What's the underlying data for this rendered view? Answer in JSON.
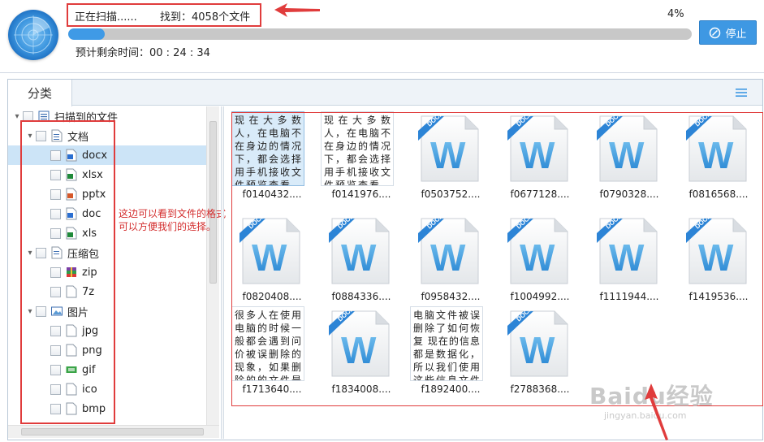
{
  "scan": {
    "status": "正在扫描......",
    "found": "找到：4058个文件",
    "percent": "4%",
    "progress": 0.04,
    "eta": "预计剩余时间：00 : 24 : 34",
    "stop_label": "停止"
  },
  "panel": {
    "tab": "分类"
  },
  "tree": {
    "items": [
      {
        "label": "扫描到的文件",
        "level": 0,
        "toggle": "▾",
        "icon": "list-icon"
      },
      {
        "label": "文档",
        "level": 1,
        "toggle": "▾",
        "icon": "document-folder-icon"
      },
      {
        "label": "docx",
        "level": 2,
        "toggle": "",
        "icon": "docx-file-icon",
        "selected": true
      },
      {
        "label": "xlsx",
        "level": 2,
        "toggle": "",
        "icon": "xlsx-file-icon"
      },
      {
        "label": "pptx",
        "level": 2,
        "toggle": "",
        "icon": "pptx-file-icon"
      },
      {
        "label": "doc",
        "level": 2,
        "toggle": "",
        "icon": "doc-file-icon"
      },
      {
        "label": "xls",
        "level": 2,
        "toggle": "",
        "icon": "xls-file-icon"
      },
      {
        "label": "压缩包",
        "level": 1,
        "toggle": "▾",
        "icon": "archive-folder-icon"
      },
      {
        "label": "zip",
        "level": 2,
        "toggle": "",
        "icon": "zip-file-icon"
      },
      {
        "label": "7z",
        "level": 2,
        "toggle": "",
        "icon": "blank-file-icon"
      },
      {
        "label": "图片",
        "level": 1,
        "toggle": "▾",
        "icon": "image-folder-icon"
      },
      {
        "label": "jpg",
        "level": 2,
        "toggle": "",
        "icon": "blank-file-icon"
      },
      {
        "label": "png",
        "level": 2,
        "toggle": "",
        "icon": "blank-file-icon"
      },
      {
        "label": "gif",
        "level": 2,
        "toggle": "",
        "icon": "gif-file-icon"
      },
      {
        "label": "ico",
        "level": 2,
        "toggle": "",
        "icon": "blank-file-icon"
      },
      {
        "label": "bmp",
        "level": 2,
        "toggle": "",
        "icon": "blank-file-icon"
      }
    ]
  },
  "annotation": {
    "line1": "这边可以看到文件的格式",
    "line2": "可以方便我们的选择。"
  },
  "files": [
    {
      "name": "f0140432....",
      "type": "text",
      "selected": true,
      "preview": "现在大多数人，在电脑不在身边的情况下，都会选择用手机接收文件预览查看，所以手机对"
    },
    {
      "name": "f0141976....",
      "type": "text",
      "preview": "现在大多数人，在电脑不在身边的情况下，都会选择用手机接收文件预览查看，所以手机对"
    },
    {
      "name": "f0503752....",
      "type": "docx"
    },
    {
      "name": "f0677128....",
      "type": "docx"
    },
    {
      "name": "f0790328....",
      "type": "docx"
    },
    {
      "name": "f0816568....",
      "type": "docx"
    },
    {
      "name": "f0820408....",
      "type": "docx"
    },
    {
      "name": "f0884336....",
      "type": "docx"
    },
    {
      "name": "f0958432....",
      "type": "docx"
    },
    {
      "name": "f1004992....",
      "type": "docx"
    },
    {
      "name": "f1111944....",
      "type": "docx"
    },
    {
      "name": "f1419536....",
      "type": "docx"
    },
    {
      "name": "f1713640....",
      "type": "text",
      "preview": "很多人在使用电脑的时候一般都会遇到问价被误删除的现象，如果删除的的文件是我们不"
    },
    {
      "name": "f1834008....",
      "type": "docx"
    },
    {
      "name": "f1892400....",
      "type": "text",
      "preview": "电脑文件被误删除了如何恢复 现在的信息都是数据化，所以我们使用这些信息文件的时候"
    },
    {
      "name": "f2788368....",
      "type": "docx"
    }
  ],
  "docx_badge": "DOCX",
  "docx_letter": "W",
  "watermark": {
    "brand": "Baidu经验",
    "sub": "jingyan.baidu.com"
  },
  "colors": {
    "accent": "#3e98e3",
    "annotation": "#e03c3c",
    "selection": "#cce4f7"
  }
}
